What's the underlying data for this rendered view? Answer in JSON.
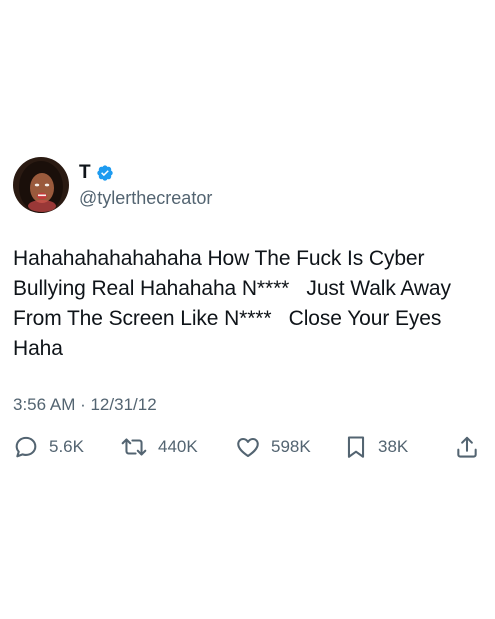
{
  "user": {
    "display_name": "T",
    "handle": "@tylerthecreator",
    "verified_color": "#1d9bf0"
  },
  "tweet": {
    "text": "Hahahahahahahaha How The Fuck Is Cyber Bullying Real Hahahaha N****   Just Walk Away From The Screen Like N****   Close Your Eyes Haha",
    "timestamp": "3:56 AM · 12/31/12"
  },
  "actions": {
    "replies": "5.6K",
    "retweets": "440K",
    "likes": "598K",
    "bookmarks": "38K"
  },
  "icons": [
    "reply-icon",
    "retweet-icon",
    "like-icon",
    "bookmark-icon",
    "share-icon",
    "verified-badge-icon"
  ]
}
